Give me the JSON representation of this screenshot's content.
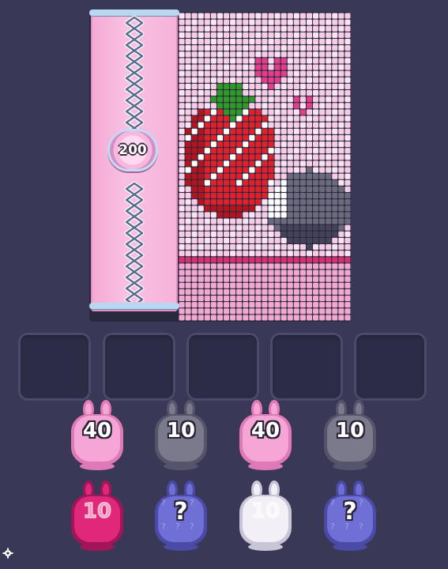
{
  "game": {
    "counter_value": "200",
    "puzzle": {
      "art": "strawberry-and-bunny-pixel-art"
    }
  },
  "slots": {
    "count": 5,
    "empty": true
  },
  "queue": {
    "front_row": [
      {
        "label": "40",
        "color": "#f6a6d6",
        "shade": "#e07ab7",
        "state": "ready"
      },
      {
        "label": "10",
        "color": "#7b7a8d",
        "shade": "#55546a",
        "state": "ready"
      },
      {
        "label": "40",
        "color": "#f6a6d6",
        "shade": "#e07ab7",
        "state": "ready"
      },
      {
        "label": "10",
        "color": "#7b7a8d",
        "shade": "#55546a",
        "state": "ready"
      }
    ],
    "back_row": [
      {
        "label": "10",
        "color": "#e0287a",
        "shade": "#a3145a",
        "state": "waiting"
      },
      {
        "label": "?",
        "color": "#6f6fd6",
        "shade": "#4b4aa7",
        "state": "hidden"
      },
      {
        "label": "10",
        "color": "#f2f0f6",
        "shade": "#c9c4d6",
        "state": "waiting"
      },
      {
        "label": "?",
        "color": "#6f6fd6",
        "shade": "#4b4aa7",
        "state": "hidden"
      }
    ]
  },
  "palette": {
    "background": "#3a3857",
    "grid_pink": "#f5b6da",
    "strawberry_red": "#e0202a",
    "leaf_green": "#2f9a25",
    "bunny_grey": "#6c6b7d"
  }
}
